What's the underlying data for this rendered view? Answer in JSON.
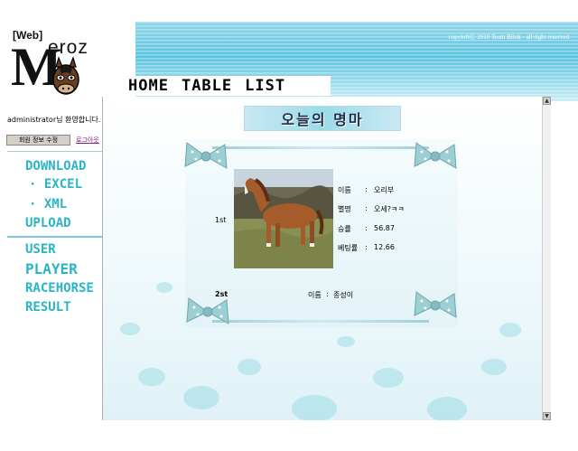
{
  "header": {
    "logo_web": "[Web]",
    "logo_m": "M",
    "logo_eroz": "eroz",
    "copyright": "copyleftⒸ 2010 Team Blink - all right reserved"
  },
  "nav": {
    "items": [
      {
        "label": "HOME"
      },
      {
        "label": "TABLE"
      },
      {
        "label": "LIST"
      }
    ]
  },
  "sidebar": {
    "welcome": "administrator님  환영합니다.",
    "edit_profile": "회원 정보 수정",
    "logout": "로그아웃",
    "links": {
      "download": "DOWNLOAD",
      "excel": "· EXCEL",
      "xml": "· XML",
      "upload": "UPLOAD",
      "user": "USER",
      "player": "PLAYER",
      "racehorse": "RACEHORSE",
      "result": "RESULT"
    }
  },
  "content": {
    "title": "오늘의 명마",
    "first": {
      "rank": "1st",
      "rows": [
        {
          "label": "이름",
          "value": "오리부"
        },
        {
          "label": "별명",
          "value": "오세?ㅋㅋ"
        },
        {
          "label": "승률",
          "value": "56.87"
        },
        {
          "label": "베팅률",
          "value": "12.66"
        }
      ]
    },
    "second": {
      "rank": "2st",
      "name_label": "이름",
      "name": "종성이"
    }
  },
  "colors": {
    "accent": "#2ab5c6",
    "header_blue": "#5cc3de"
  }
}
